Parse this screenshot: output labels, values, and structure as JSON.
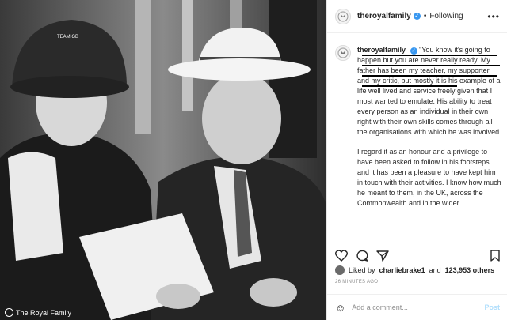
{
  "photo": {
    "credit": "The Royal Family",
    "hat_text": "TEAM GB"
  },
  "post": {
    "username": "theroyalfamily",
    "verified_icon": "verified-badge-icon",
    "following_label": "Following",
    "caption_para1": "\"You know it's going to happen but you are never really ready. My father has been my teacher, my supporter and my critic, but mostly it is his example of a life well lived and service freely given that I most wanted to emulate. His ability to treat every person as an individual in their own right with their own skills comes through all the organisations with which he was involved.",
    "caption_para2": "I regard it as an honour and a privilege to have been asked to follow in his footsteps and it has been a pleasure to have kept him in touch with their activities. I know how much he meant to them, in the UK, across the Commonwealth and in the wider",
    "liked_by_prefix": "Liked by",
    "liked_by_user": "charliebrake1",
    "and_label": "and",
    "likes_count": "123,953 others",
    "timestamp": "26 MINUTES AGO",
    "comment_placeholder": "Add a comment...",
    "post_label": "Post",
    "colors": {
      "verified": "#3897f0",
      "post_disabled": "#b2dffc"
    }
  }
}
